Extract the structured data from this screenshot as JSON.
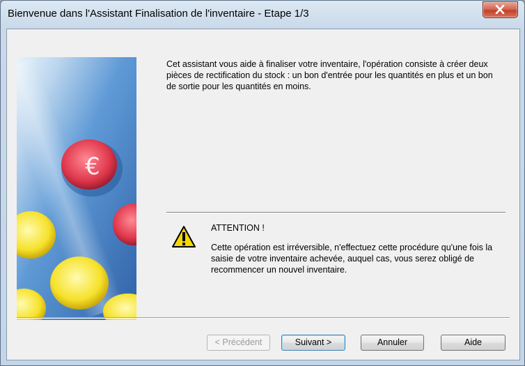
{
  "window": {
    "title": "Bienvenue dans l'Assistant Finalisation de l'inventaire - Etape 1/3",
    "close_icon": "close-x-icon"
  },
  "intro": {
    "text": "Cet assistant vous aide à finaliser votre inventaire, l'opération consiste à créer deux pièces de rectification du stock : un bon d'entrée pour les quantités en plus et un bon de sortie pour les quantités en moins."
  },
  "attention": {
    "icon": "warning-icon",
    "title": "ATTENTION !",
    "text": "Cette opération est irréversible, n'effectuez cette procédure qu'une fois la saisie de votre inventaire achevée, auquel cas, vous serez obligé de recommencer un nouvel inventaire."
  },
  "buttons": {
    "previous": "< Précédent",
    "next": "Suivant >",
    "cancel": "Annuler",
    "help": "Aide"
  },
  "colors": {
    "close_button": "#c2412a",
    "image_blue": "#3f7fc8",
    "warning_yellow": "#f5d800"
  }
}
